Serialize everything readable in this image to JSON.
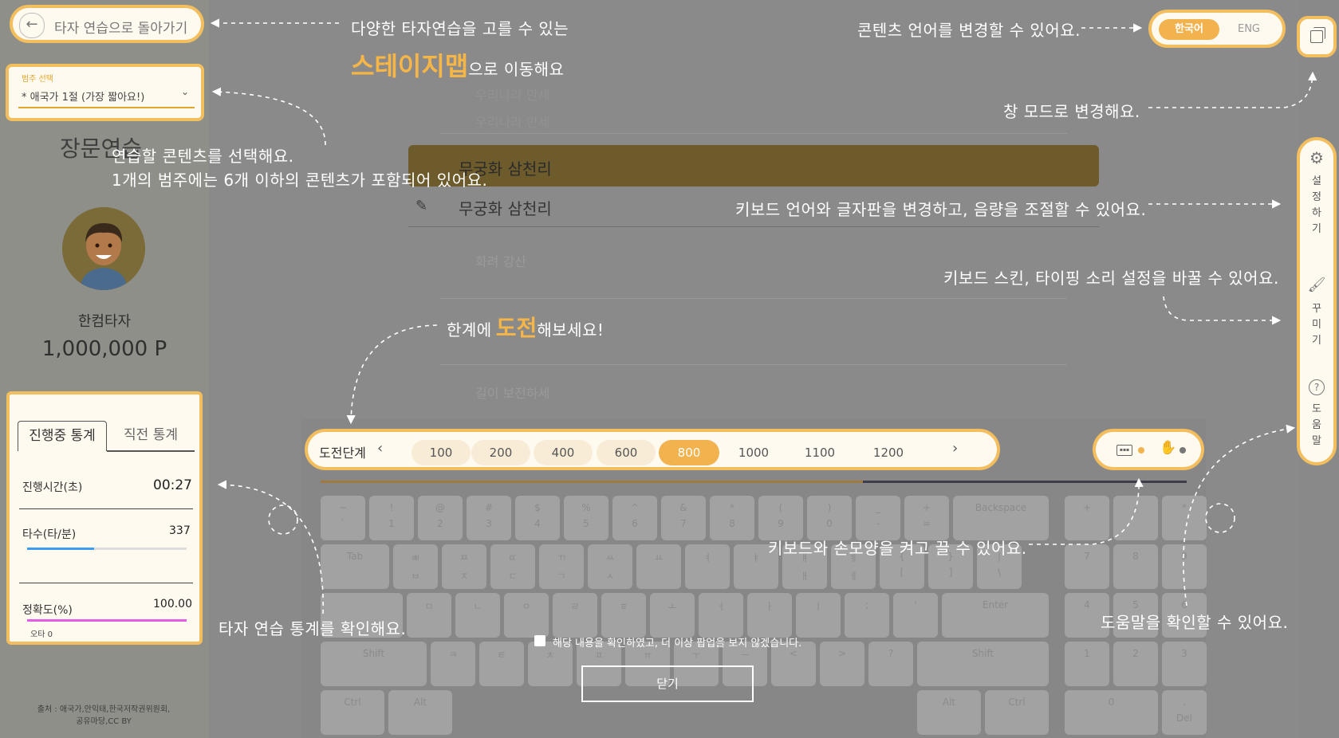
{
  "nav": {
    "back_label": "타자 연습으로 돌아가기"
  },
  "category": {
    "label": "범주 선택",
    "selected": "* 애국가 1절 (가장 짧아요!)"
  },
  "mode_title": "장문연습",
  "user": {
    "name": "한컴타자",
    "points": "1,000,000 P"
  },
  "stats": {
    "tabs": [
      "진행중 통계",
      "직전 통계"
    ],
    "time_label": "진행시간(초)",
    "time_value": "00:27",
    "speed_label": "타수(타/분)",
    "speed_value": "337",
    "speed_progress": 0.42,
    "accuracy_label": "정확도(%)",
    "accuracy_value": "100.00",
    "accuracy_progress": 1.0,
    "typo_label": "오타 0"
  },
  "source": "출처 : 애국가,안익태,한국저작권위원회,공유마당,CC BY",
  "language": {
    "korean": "한국어",
    "english": "ENG",
    "selected": "한국어"
  },
  "side_menu": {
    "settings": "설정하기",
    "decorate": "꾸미기",
    "help": "도움말"
  },
  "text_lines": [
    "우리나라 만세",
    "우리나라 만세",
    "무궁화 삼천리",
    "무궁화 삼천리",
    "화려 강산",
    "길이 보전하세"
  ],
  "challenge": {
    "label": "도전단계",
    "levels": [
      "100",
      "200",
      "400",
      "600",
      "800",
      "1000",
      "1100",
      "1200"
    ],
    "selected": "800"
  },
  "keyboard": {
    "row1": [
      [
        "~",
        "`"
      ],
      [
        "!",
        "1"
      ],
      [
        "@",
        "2"
      ],
      [
        "#",
        "3"
      ],
      [
        "$",
        "4"
      ],
      [
        "%",
        "5"
      ],
      [
        "^",
        "6"
      ],
      [
        "&",
        "7"
      ],
      [
        "*",
        "8"
      ],
      [
        "(",
        "9"
      ],
      [
        ")",
        "0"
      ],
      [
        "_",
        "-"
      ],
      [
        "+",
        "="
      ]
    ],
    "backspace": "Backspace",
    "tab": "Tab",
    "enter": "Enter",
    "shift": "Shift",
    "ctrl": "Ctrl",
    "alt": "Alt",
    "del": "Del",
    "row2": [
      [
        "ㅃ",
        "ㅂ"
      ],
      [
        "ㅉ",
        "ㅈ"
      ],
      [
        "ㄸ",
        "ㄷ"
      ],
      [
        "ㄲ",
        "ㄱ"
      ],
      [
        "ㅆ",
        "ㅅ"
      ],
      [
        "",
        "ㅛ"
      ],
      [
        "",
        "ㅕ"
      ],
      [
        "",
        "ㅑ"
      ],
      [
        "ㅒ",
        "ㅐ"
      ],
      [
        "ㅖ",
        "ㅔ"
      ],
      [
        "{",
        "["
      ],
      [
        "}",
        "]"
      ],
      [
        "|",
        "\\"
      ]
    ],
    "row3": [
      "ㅁ",
      "ㄴ",
      "ㅇ",
      "ㄹ",
      "ㅎ",
      "ㅗ",
      "ㅓ",
      "ㅏ",
      "ㅣ",
      ";",
      "'"
    ],
    "row4": [
      "ㅋ",
      "ㅌ",
      "ㅊ",
      "ㅍ",
      "ㅠ",
      "ㅜ",
      "ㅡ",
      "<",
      ">",
      "?"
    ],
    "numpad": [
      "+",
      "-",
      "*",
      "7",
      "8",
      "9",
      "4",
      "5",
      "6",
      "1",
      "2",
      "3",
      "0",
      "."
    ]
  },
  "popup": {
    "checkbox_label": "해당 내용을 확인하였고, 더 이상 팝업을 보지 않겠습니다.",
    "close": "닫기"
  },
  "tips": {
    "stage_map_1": "다양한 타자연습을 고를 수 있는",
    "stage_map_big": "스테이지맵",
    "stage_map_2": "으로 이동해요",
    "language": "콘텐츠 언어를 변경할 수 있어요.",
    "window": "창 모드로 변경해요.",
    "content_1": "연습할 콘텐츠를 선택해요.",
    "content_2": "1개의 범주에는 6개 이하의 콘텐츠가 포함되어 있어요.",
    "keyboard_lang": "키보드 언어와 글자판을 변경하고, 음량을 조절할 수 있어요.",
    "skin": "키보드 스킨, 타이핑 소리 설정을 바꿀 수 있어요.",
    "challenge_1": "한계에",
    "challenge_big": "도전",
    "challenge_2": "해보세요!",
    "hands": "키보드와 손모양을 켜고 끌 수 있어요.",
    "stats": "타자 연습 통계를 확인해요.",
    "help": "도움말을 확인할 수 있어요."
  },
  "colors": {
    "accent": "#f3be5d",
    "speed_bar": "#3d9cf0",
    "accuracy_bar": "#e45be8"
  }
}
